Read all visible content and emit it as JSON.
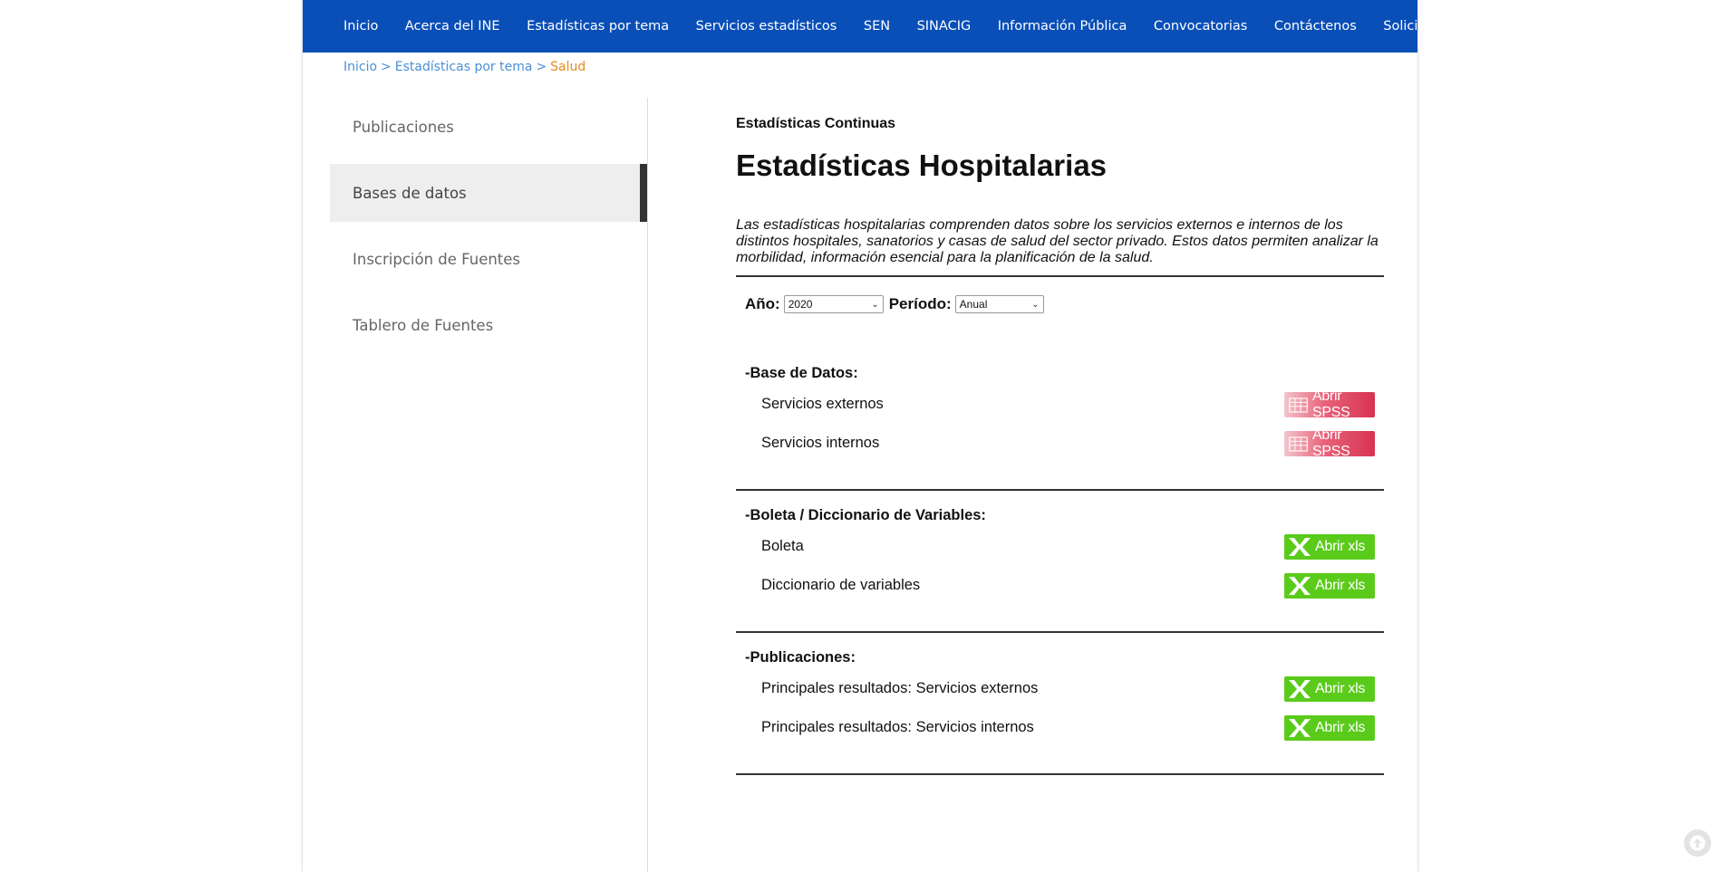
{
  "nav": {
    "items": [
      "Inicio",
      "Acerca del INE",
      "Estadísticas por tema",
      "Servicios estadísticos",
      "SEN",
      "SINACIG",
      "Información Pública",
      "Convocatorias",
      "Contáctenos",
      "Solicitudes"
    ]
  },
  "breadcrumb": {
    "items": [
      "Inicio",
      "Estadísticas por tema"
    ],
    "separator": ">",
    "current": "Salud"
  },
  "sidebar": {
    "items": [
      {
        "label": "Publicaciones",
        "active": false
      },
      {
        "label": "Bases de datos",
        "active": true
      },
      {
        "label": "Inscripción de Fuentes",
        "active": false
      },
      {
        "label": "Tablero de Fuentes",
        "active": false
      }
    ]
  },
  "content": {
    "subtitle": "Estadísticas Continuas",
    "title": "Estadísticas Hospitalarias",
    "description": "Las estadísticas hospitalarias comprenden datos sobre los servicios externos e internos de los distintos hospitales, sanatorios y casas de salud del sector privado. Estos datos permiten analizar la morbilidad, información esencial para la planificación de la salud."
  },
  "filters": {
    "year_label": "Año:",
    "year_value": "2020",
    "period_label": "Período:",
    "period_value": "Anual"
  },
  "sections": [
    {
      "heading": "-Base de Datos:",
      "rows": [
        {
          "label": "Servicios externos",
          "button": "Abrir SPSS",
          "kind": "spss"
        },
        {
          "label": "Servicios internos",
          "button": "Abrir SPSS",
          "kind": "spss"
        }
      ]
    },
    {
      "heading": "-Boleta / Diccionario de Variables:",
      "rows": [
        {
          "label": "Boleta",
          "button": "Abrir xls",
          "kind": "xls"
        },
        {
          "label": "Diccionario de variables",
          "button": "Abrir xls",
          "kind": "xls"
        }
      ]
    },
    {
      "heading": "-Publicaciones:",
      "rows": [
        {
          "label": "Principales resultados: Servicios externos",
          "button": "Abrir xls",
          "kind": "xls"
        },
        {
          "label": "Principales resultados: Servicios internos",
          "button": "Abrir xls",
          "kind": "xls"
        }
      ]
    }
  ],
  "colors": {
    "nav_bg": "#0a4fb8",
    "breadcrumb_link": "#4a8fd6",
    "breadcrumb_current": "#e98a1a",
    "xls_green": "#5acb1a",
    "spss_red": "#d63350"
  },
  "icons": {
    "spss": "spreadsheet-grid-icon",
    "xls": "excel-x-icon",
    "scroll": "arrow-up-icon"
  }
}
